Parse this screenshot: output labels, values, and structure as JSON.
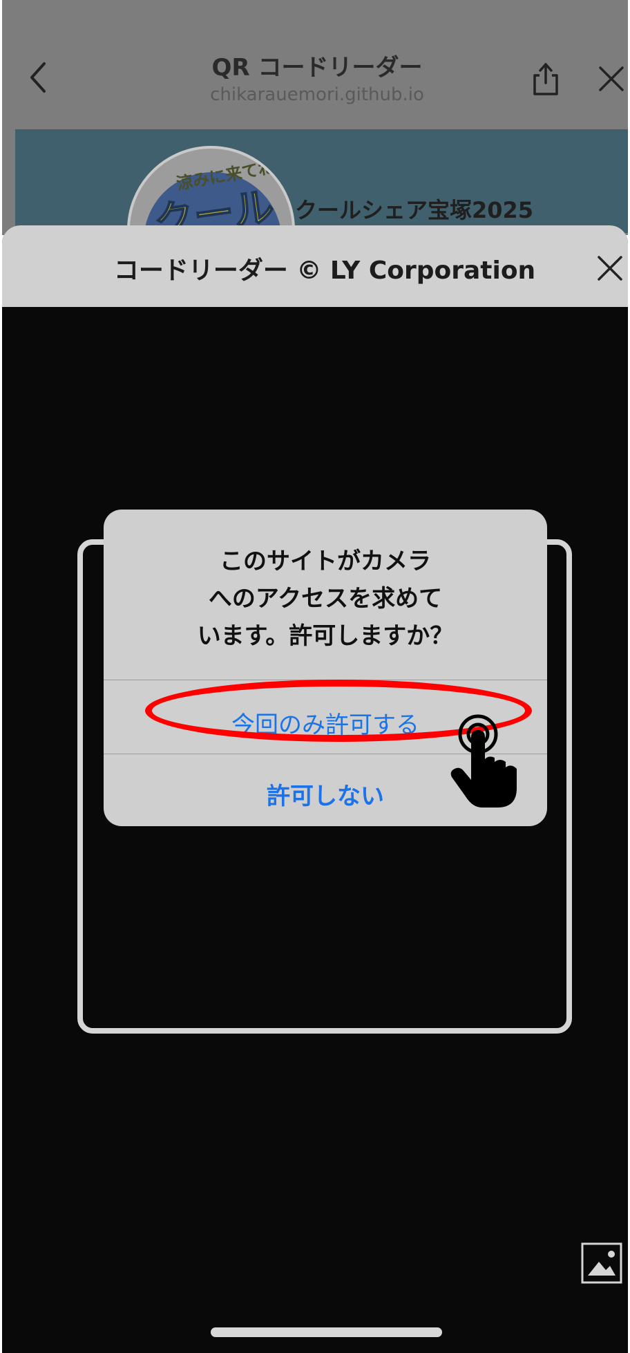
{
  "browser": {
    "title": "QR コードリーダー",
    "domain": "chikarauemori.github.io",
    "back_icon": "chevron-left-icon",
    "share_icon": "share-icon",
    "close_icon": "close-icon"
  },
  "banner": {
    "logo_text_top": "涼みに来てね!",
    "logo_text_main": "クール",
    "heading": "クールシェア宝塚2025"
  },
  "sheet": {
    "title": "コードリーダー © LY Corporation",
    "close_icon": "close-icon",
    "gallery_icon": "photo-icon"
  },
  "dialog": {
    "message_lines": [
      "このサイトがカメラ",
      "へのアクセスを求めて",
      "います。許可しますか？"
    ],
    "allow_once_label": "今回のみ許可する",
    "deny_label": "許可しない"
  },
  "colors": {
    "accent": "#1a73e8",
    "highlight": "#ff0000",
    "banner": "#41606d"
  }
}
